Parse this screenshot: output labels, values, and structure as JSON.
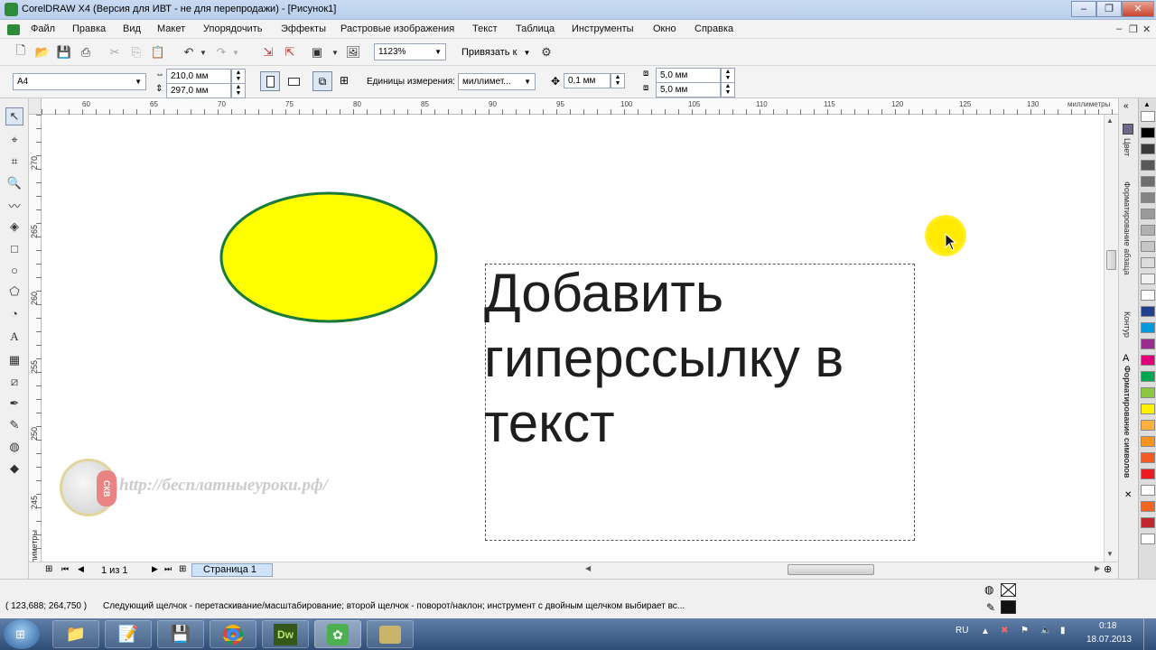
{
  "window": {
    "title": "CorelDRAW X4 (Версия для ИВТ - не для перепродажи) - [Рисунок1]"
  },
  "menu": [
    "Файл",
    "Правка",
    "Вид",
    "Макет",
    "Упорядочить",
    "Эффекты",
    "Растровые изображения",
    "Текст",
    "Таблица",
    "Инструменты",
    "Окно",
    "Справка"
  ],
  "toolbar": {
    "zoom": "1123%",
    "snap_label": "Привязать к"
  },
  "propbar": {
    "page_size": "A4",
    "width": "210,0 мм",
    "height": "297,0 мм",
    "units_label": "Единицы измерения:",
    "units_value": "миллимет...",
    "nudge": "0,1 мм",
    "dup_x": "5,0 мм",
    "dup_y": "5,0 мм"
  },
  "ruler": {
    "h_ticks": [
      "60",
      "65",
      "70",
      "75",
      "80",
      "85",
      "90",
      "95",
      "100",
      "105",
      "110",
      "115",
      "120",
      "125",
      "130"
    ],
    "h_unit": "миллиметры",
    "v_ticks": [
      "270",
      "265",
      "260",
      "255",
      "250",
      "245"
    ],
    "v_unit": "миллиметры"
  },
  "canvas": {
    "text_lines": [
      "Добавить",
      "гиперссылку в",
      "текст"
    ],
    "ellipse_fill": "#ffff00",
    "ellipse_stroke": "#1a7a3a",
    "watermark_url": "http://бесплатныеуроки.рф/",
    "logo_text": "СКВ"
  },
  "page_nav": {
    "counter": "1 из 1",
    "tab": "Страница 1"
  },
  "dockers": [
    "Цвет",
    "Форматирование абзаца",
    "Контур",
    "Форматирование символов"
  ],
  "palette": [
    "#ffffff",
    "#000000",
    "#3a3a3a",
    "#585858",
    "#6e6e6e",
    "#848484",
    "#9a9a9a",
    "#b0b0b0",
    "#c6c6c6",
    "#dcdcdc",
    "#f0f0f0",
    "#ffffff",
    "#1f3f8f",
    "#0099dd",
    "#9b2d8f",
    "#e0007a",
    "#00a651",
    "#8dc63f",
    "#fff200",
    "#fbb040",
    "#f7941d",
    "#f15a24",
    "#ed1c24",
    "#ffffff",
    "#f26522",
    "#c1272d",
    "#ffffff"
  ],
  "status": {
    "coords": "( 123,688; 264,750 )",
    "hint": "Следующий щелчок - перетаскивание/масштабирование; второй щелчок - поворот/наклон; инструмент с двойным щелчком выбирает вс..."
  },
  "taskbar": {
    "lang": "RU",
    "time": "0:18",
    "date": "18.07.2013",
    "apps": [
      "Проводник",
      "Блокнот",
      "Сохранение",
      "Google Chrome",
      "Dw",
      "CorelDRAW",
      "Corel"
    ]
  }
}
